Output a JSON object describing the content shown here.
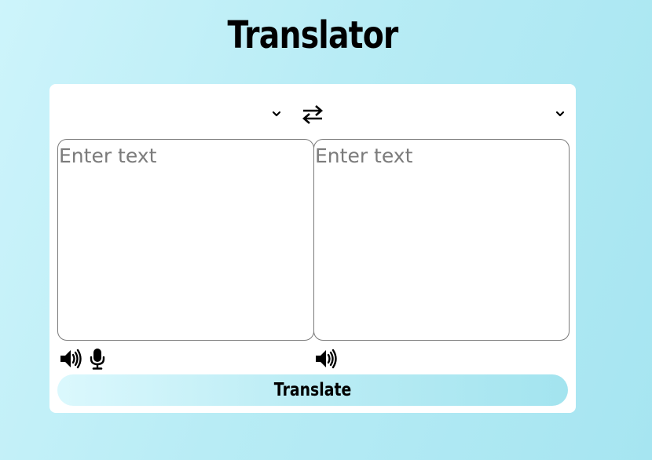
{
  "header": {
    "title": "Translator"
  },
  "languages": {
    "from_value": "",
    "to_value": ""
  },
  "input": {
    "placeholder": "Enter text",
    "value": ""
  },
  "output": {
    "placeholder": "Enter text",
    "value": ""
  },
  "icons": {
    "swap": "exchange-arrows-icon",
    "from_speaker": "volume-icon",
    "from_mic": "microphone-icon",
    "to_speaker": "volume-icon"
  },
  "actions": {
    "translate_label": "Translate"
  },
  "colors": {
    "background_start": "#cdf4fb",
    "background_end": "#a6e5f1",
    "card": "#ffffff",
    "button_start": "#dbf8fd",
    "button_end": "#a3e4ef",
    "placeholder": "#7b7b7b"
  }
}
